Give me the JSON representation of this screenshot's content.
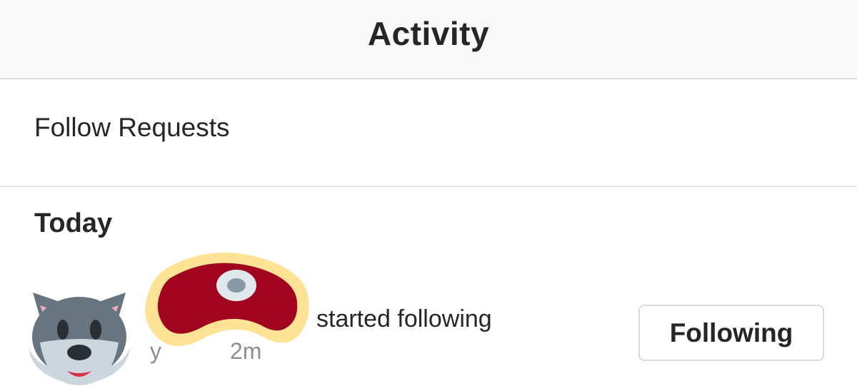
{
  "header": {
    "title": "Activity"
  },
  "follow_requests": {
    "label": "Follow Requests"
  },
  "today_section": {
    "heading": "Today",
    "items": [
      {
        "text": "started following",
        "time_prefix": "y",
        "time": "2m",
        "button_label": "Following",
        "avatar_icon": "wolf-emoji-icon",
        "overlay_icon": "steak-emoji-icon"
      }
    ]
  }
}
